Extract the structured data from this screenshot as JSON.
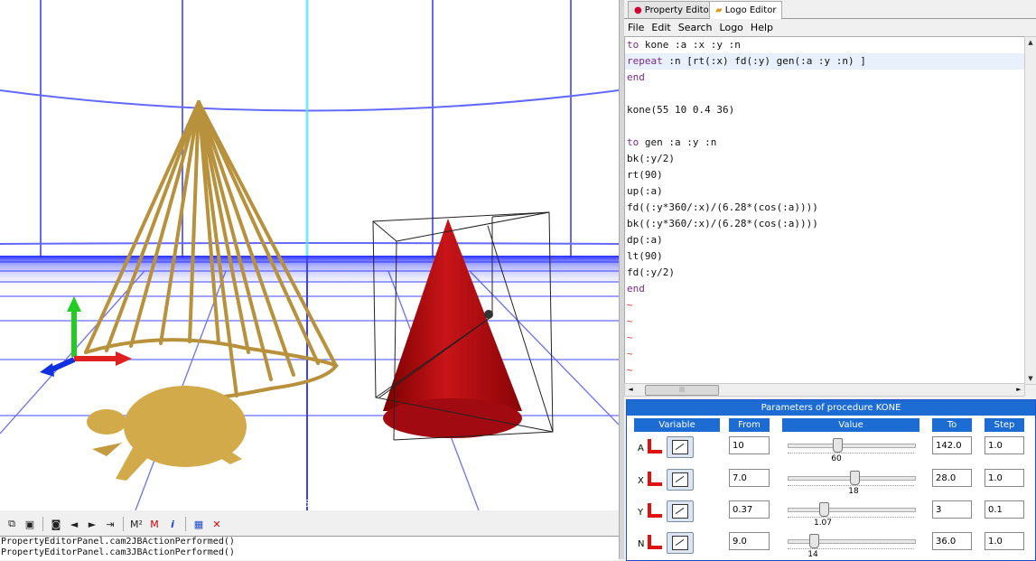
{
  "tabs": [
    {
      "label": "Property Editor",
      "active": false
    },
    {
      "label": "Logo Editor",
      "active": true
    }
  ],
  "menu": [
    "File",
    "Edit",
    "Search",
    "Logo",
    "Help"
  ],
  "code_lines": [
    {
      "text": "to kone :a :x :y :n",
      "kw": "to"
    },
    {
      "text": "repeat :n [rt(:x) fd(:y) gen(:a :y :n) ]",
      "kw": "repeat",
      "hl": true
    },
    {
      "text": "end",
      "kw": "end"
    },
    {
      "text": ""
    },
    {
      "text": "kone(55 10 0.4 36)"
    },
    {
      "text": ""
    },
    {
      "text": "to gen :a :y :n",
      "kw": "to"
    },
    {
      "text": "bk(:y/2)"
    },
    {
      "text": "rt(90)"
    },
    {
      "text": "up(:a)"
    },
    {
      "text": "fd((:y*360/:x)/(6.28*(cos(:a))))"
    },
    {
      "text": "bk((:y*360/:x)/(6.28*(cos(:a))))"
    },
    {
      "text": "dp(:a)"
    },
    {
      "text": "lt(90)"
    },
    {
      "text": "fd(:y/2)"
    },
    {
      "text": "end",
      "kw": "end"
    },
    {
      "text": "~",
      "tilde": true
    },
    {
      "text": "~",
      "tilde": true
    },
    {
      "text": "~",
      "tilde": true
    },
    {
      "text": "~",
      "tilde": true
    },
    {
      "text": "~",
      "tilde": true
    }
  ],
  "params": {
    "title": "Parameters of procedure KONE",
    "headers": {
      "variable": "Variable",
      "from": "From",
      "value": "Value",
      "to": "To",
      "step": "Step"
    },
    "rows": [
      {
        "var": "A",
        "from": "10",
        "value": "60",
        "fraction": 0.378,
        "to": "142.0",
        "step": "1.0"
      },
      {
        "var": "X",
        "from": "7.0",
        "value": "18",
        "fraction": 0.524,
        "to": "28.0",
        "step": "1.0"
      },
      {
        "var": "Y",
        "from": "0.37",
        "value": "1.07",
        "fraction": 0.266,
        "to": "3",
        "step": "0.1"
      },
      {
        "var": "N",
        "from": "9.0",
        "value": "14",
        "fraction": 0.185,
        "to": "36.0",
        "step": "1.0"
      }
    ]
  },
  "console_lines": [
    "PropertyEditorPanel.cam2JBActionPerformed()",
    "PropertyEditorPanel.cam3JBActionPerformed()"
  ],
  "viewport_label": "5",
  "toolbar_icons": [
    "copy-icon",
    "save-icon",
    "binoculars-icon",
    "binoculars-back-icon",
    "binoculars-forward-icon",
    "insert-icon",
    "m-squared-icon",
    "m-delete-icon",
    "info-icon",
    "grid-icon",
    "close-icon"
  ],
  "toolbar_glyphs": {
    "m2": "M²",
    "mx": "M",
    "info": "i",
    "close": "✕"
  },
  "colors": {
    "accent": "#1c6cd4",
    "cone": "#b81218",
    "wire": "#b8913c",
    "grid": "#1a22ff"
  }
}
